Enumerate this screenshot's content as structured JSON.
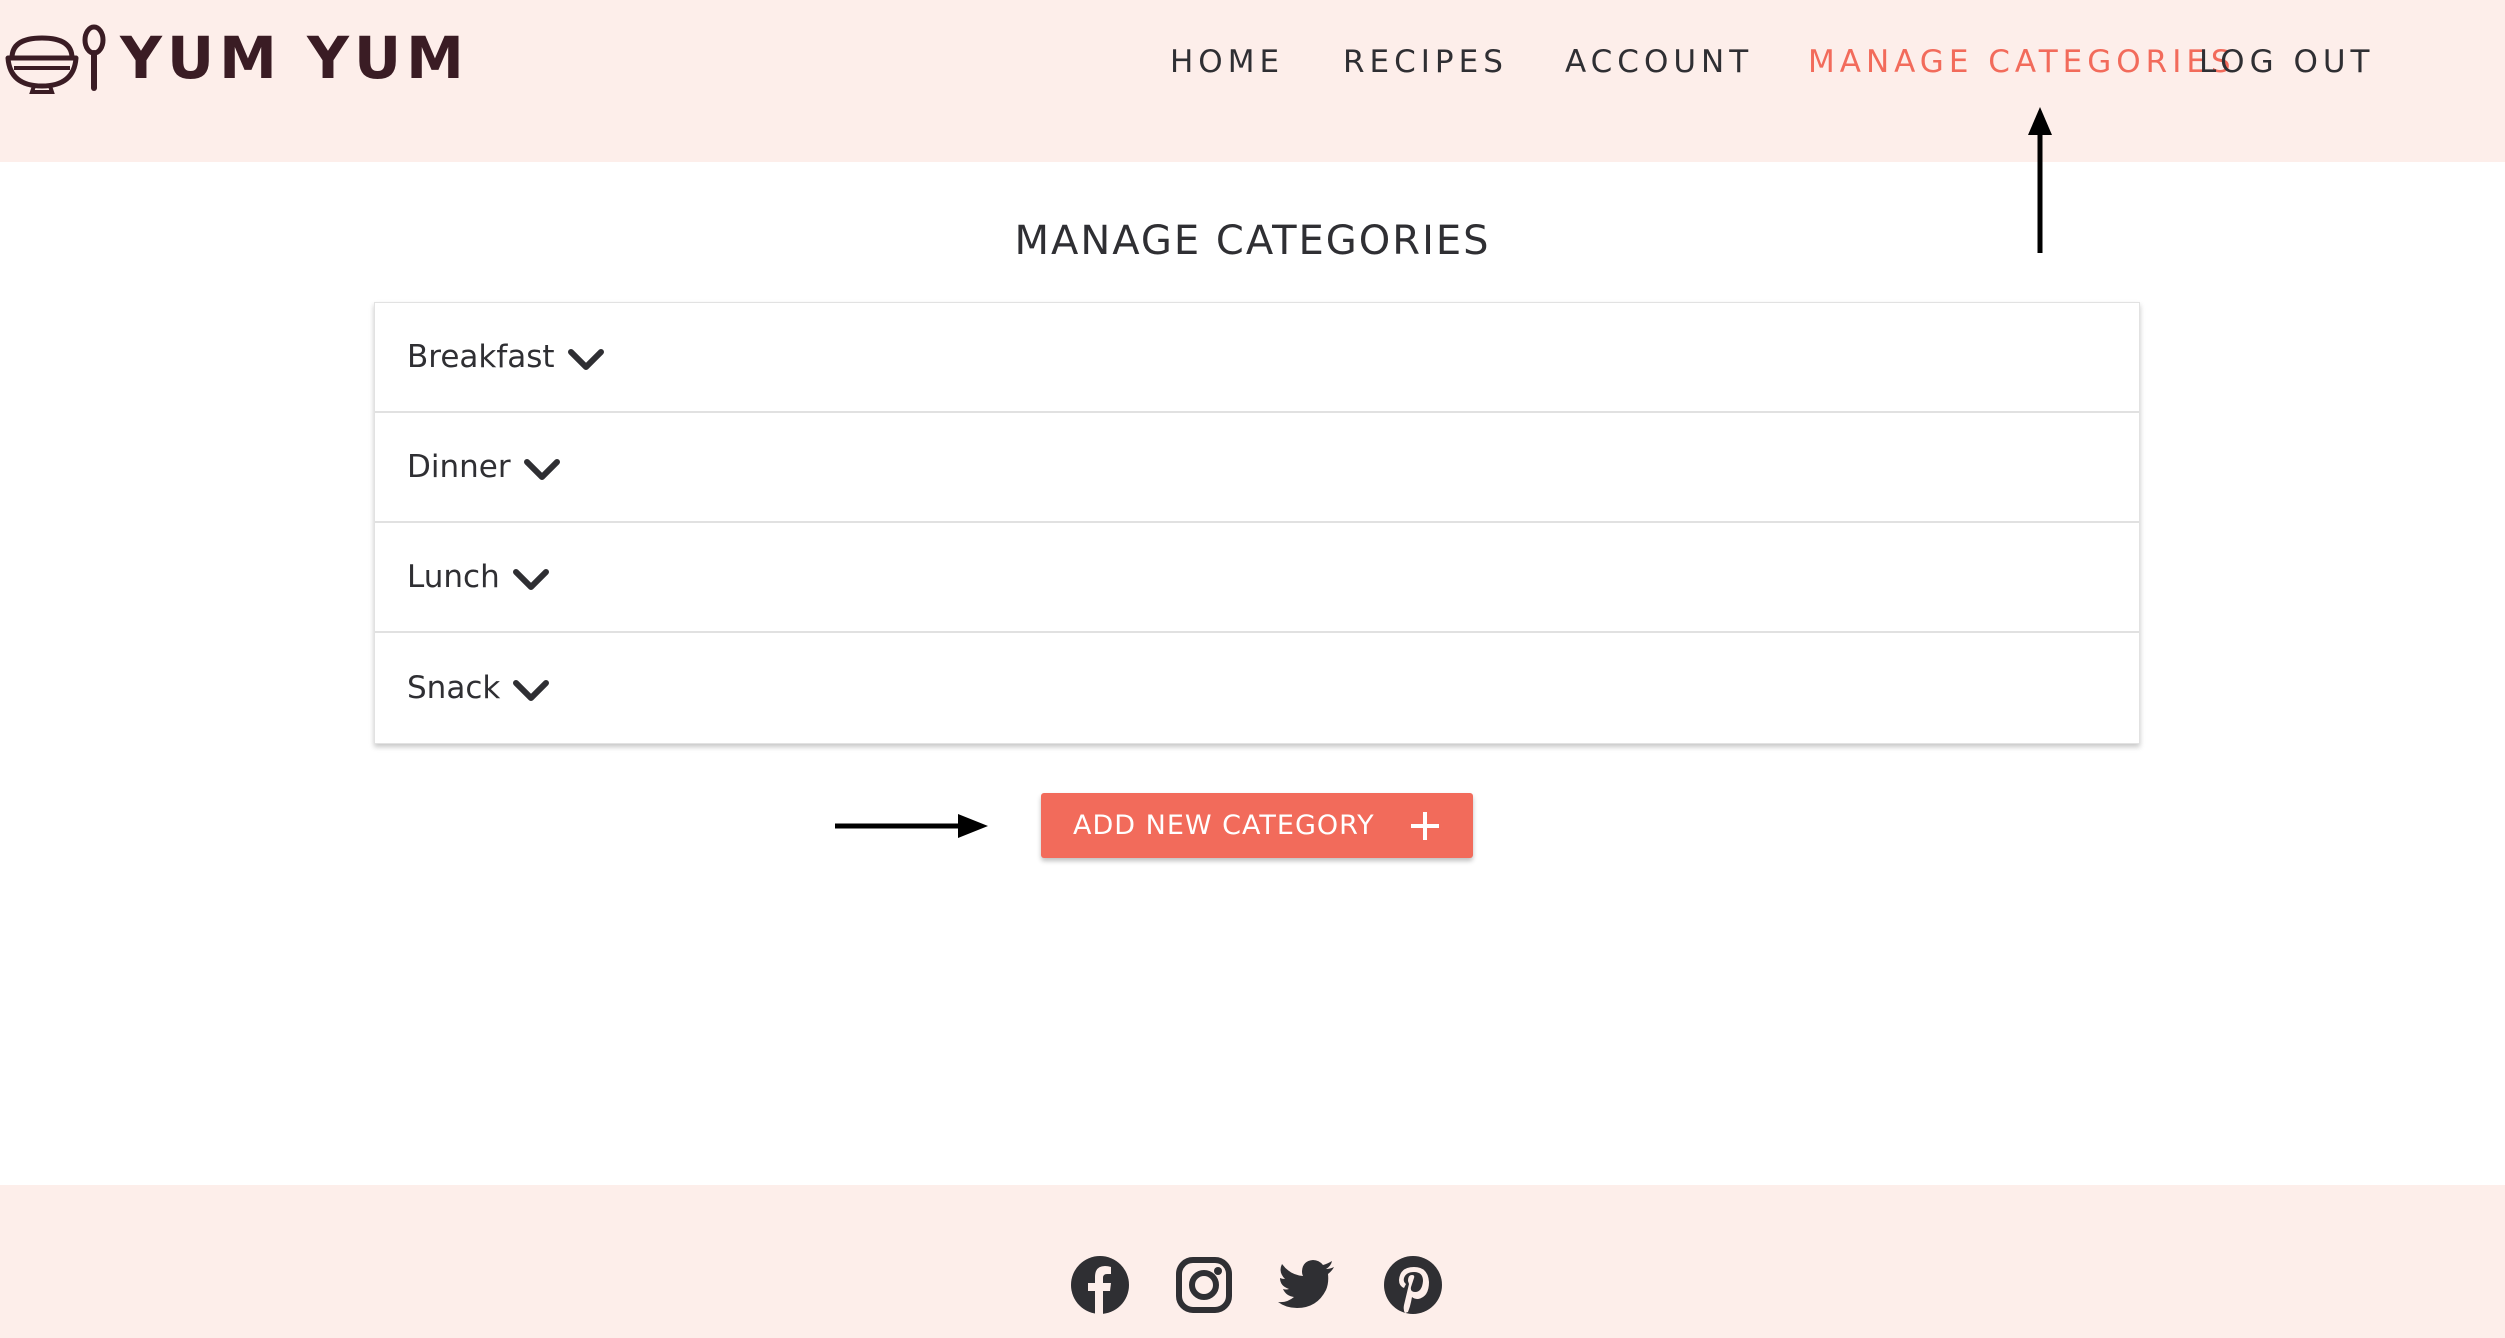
{
  "brand": {
    "name": "YUM YUM",
    "logo_icon": "bowl-spoon-icon"
  },
  "nav": {
    "items": [
      {
        "label": "HOME",
        "active": false
      },
      {
        "label": "RECIPES",
        "active": false
      },
      {
        "label": "ACCOUNT",
        "active": false
      },
      {
        "label": "MANAGE CATEGORIES",
        "active": true
      },
      {
        "label": "LOG OUT",
        "active": false
      }
    ]
  },
  "page": {
    "title": "MANAGE CATEGORIES"
  },
  "categories": [
    {
      "label": "Breakfast",
      "icon": "chevron-down-icon"
    },
    {
      "label": "Dinner",
      "icon": "chevron-down-icon"
    },
    {
      "label": "Lunch",
      "icon": "chevron-down-icon"
    },
    {
      "label": "Snack",
      "icon": "chevron-down-icon"
    }
  ],
  "actions": {
    "add_category_label": "ADD NEW CATEGORY",
    "add_icon": "plus-icon"
  },
  "footer": {
    "social": [
      "facebook-icon",
      "instagram-icon",
      "twitter-icon",
      "pinterest-icon"
    ]
  },
  "colors": {
    "accent": "#f26b5b",
    "header_bg": "#fdeeea",
    "footer_bg": "#fdeeea",
    "brand_text": "#3a1c24",
    "text": "#2f2f33"
  }
}
